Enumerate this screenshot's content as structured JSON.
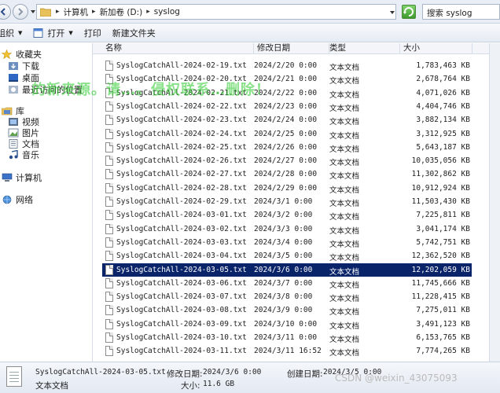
{
  "address": {
    "crumbs": [
      "计算机",
      "新加卷 (D:)",
      "syslog"
    ]
  },
  "search": {
    "placeholder": "搜索 syslog"
  },
  "toolbar": {
    "organize": "组织",
    "open": "打开",
    "print": "打印",
    "new_folder": "新建文件夹"
  },
  "nav": {
    "favorites": "收藏夹",
    "downloads": "下载",
    "desktop": "桌面",
    "recent": "最近访问的位置",
    "libraries": "库",
    "videos": "视频",
    "pictures": "图片",
    "documents": "文档",
    "music": "音乐",
    "computer": "计算机",
    "network": "网络"
  },
  "columns": {
    "name": "名称",
    "date": "修改日期",
    "type": "类型",
    "size": "大小"
  },
  "files": [
    {
      "name": "SyslogCatchAll-2024-02-19.txt",
      "date": "2024/2/20 0:00",
      "type": "文本文档",
      "size": "1,783,463 KB"
    },
    {
      "name": "SyslogCatchAll-2024-02-20.txt",
      "date": "2024/2/21 0:00",
      "type": "文本文档",
      "size": "2,678,764 KB"
    },
    {
      "name": "SyslogCatchAll-2024-02-21.txt",
      "date": "2024/2/22 0:00",
      "type": "文本文档",
      "size": "4,071,026 KB"
    },
    {
      "name": "SyslogCatchAll-2024-02-22.txt",
      "date": "2024/2/23 0:00",
      "type": "文本文档",
      "size": "4,404,746 KB"
    },
    {
      "name": "SyslogCatchAll-2024-02-23.txt",
      "date": "2024/2/24 0:00",
      "type": "文本文档",
      "size": "3,882,134 KB"
    },
    {
      "name": "SyslogCatchAll-2024-02-24.txt",
      "date": "2024/2/25 0:00",
      "type": "文本文档",
      "size": "3,312,925 KB"
    },
    {
      "name": "SyslogCatchAll-2024-02-25.txt",
      "date": "2024/2/26 0:00",
      "type": "文本文档",
      "size": "5,643,187 KB"
    },
    {
      "name": "SyslogCatchAll-2024-02-26.txt",
      "date": "2024/2/27 0:00",
      "type": "文本文档",
      "size": "10,035,056 KB"
    },
    {
      "name": "SyslogCatchAll-2024-02-27.txt",
      "date": "2024/2/28 0:00",
      "type": "文本文档",
      "size": "11,302,862 KB"
    },
    {
      "name": "SyslogCatchAll-2024-02-28.txt",
      "date": "2024/2/29 0:00",
      "type": "文本文档",
      "size": "10,912,924 KB"
    },
    {
      "name": "SyslogCatchAll-2024-02-29.txt",
      "date": "2024/3/1 0:00",
      "type": "文本文档",
      "size": "11,503,430 KB"
    },
    {
      "name": "SyslogCatchAll-2024-03-01.txt",
      "date": "2024/3/2 0:00",
      "type": "文本文档",
      "size": "7,225,811 KB"
    },
    {
      "name": "SyslogCatchAll-2024-03-02.txt",
      "date": "2024/3/3 0:00",
      "type": "文本文档",
      "size": "3,041,174 KB"
    },
    {
      "name": "SyslogCatchAll-2024-03-03.txt",
      "date": "2024/3/4 0:00",
      "type": "文本文档",
      "size": "5,742,751 KB"
    },
    {
      "name": "SyslogCatchAll-2024-03-04.txt",
      "date": "2024/3/5 0:00",
      "type": "文本文档",
      "size": "12,362,520 KB"
    },
    {
      "name": "SyslogCatchAll-2024-03-05.txt",
      "date": "2024/3/6 0:00",
      "type": "文本文档",
      "size": "12,202,059 KB",
      "selected": true
    },
    {
      "name": "SyslogCatchAll-2024-03-06.txt",
      "date": "2024/3/7 0:00",
      "type": "文本文档",
      "size": "11,745,666 KB"
    },
    {
      "name": "SyslogCatchAll-2024-03-07.txt",
      "date": "2024/3/8 0:00",
      "type": "文本文档",
      "size": "11,228,415 KB"
    },
    {
      "name": "SyslogCatchAll-2024-03-08.txt",
      "date": "2024/3/9 0:00",
      "type": "文本文档",
      "size": "7,275,011 KB"
    },
    {
      "name": "SyslogCatchAll-2024-03-09.txt",
      "date": "2024/3/10 0:00",
      "type": "文本文档",
      "size": "3,491,123 KB"
    },
    {
      "name": "SyslogCatchAll-2024-03-10.txt",
      "date": "2024/3/11 0:00",
      "type": "文本文档",
      "size": "6,153,765 KB"
    },
    {
      "name": "SyslogCatchAll-2024-03-11.txt",
      "date": "2024/3/11 16:52",
      "type": "文本文档",
      "size": "7,774,265 KB"
    }
  ],
  "details": {
    "filename": "SyslogCatchAll-2024-03-05.txt",
    "type": "文本文档",
    "modified_label": "修改日期:",
    "modified_value": "2024/3/6 0:00",
    "created_label": "创建日期:",
    "created_value": "2024/3/5 0:00",
    "size_label": "大小:",
    "size_value": "11.6 GB"
  },
  "overlay_text": "的新来源。请…。侵权联系…删除！",
  "watermark": "CSDN @weixin_43075093"
}
